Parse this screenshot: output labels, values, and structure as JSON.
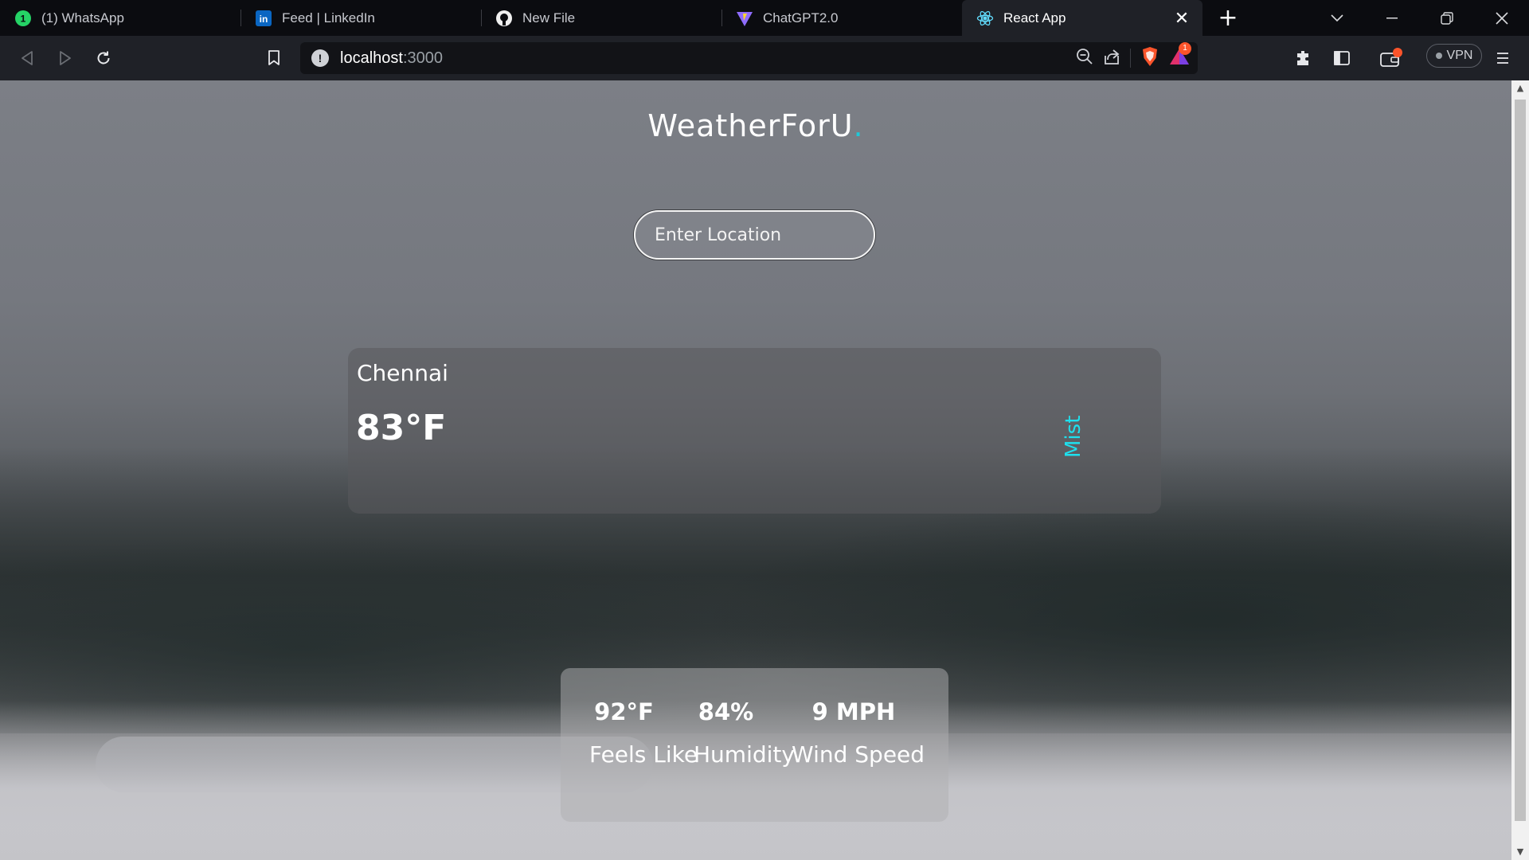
{
  "tabs": [
    {
      "title": "(1) WhatsApp",
      "icon": "whatsapp-icon"
    },
    {
      "title": "Feed | LinkedIn",
      "icon": "linkedin-icon"
    },
    {
      "title": "New File",
      "icon": "github-icon"
    },
    {
      "title": "ChatGPT2.0",
      "icon": "vite-icon"
    },
    {
      "title": "React App",
      "icon": "react-icon",
      "active": true
    }
  ],
  "address_bar": {
    "host": "localhost",
    "port": ":3000"
  },
  "vpn_label": "VPN",
  "notification_badge": "1",
  "app": {
    "title": "WeatherForU",
    "title_dot": ".",
    "search_placeholder": "Enter Location",
    "city": "Chennai",
    "temperature": "83°F",
    "description": "Mist",
    "stats": [
      {
        "value": "92°F",
        "label": "Feels Like"
      },
      {
        "value": "84%",
        "label": "Humidity"
      },
      {
        "value": "9 MPH",
        "label": "Wind Speed"
      }
    ]
  },
  "colors": {
    "accent": "#1ec8d8",
    "description": "#1ee0ee",
    "tabbar": "#0b0c10",
    "toolbar": "#1f2127"
  }
}
